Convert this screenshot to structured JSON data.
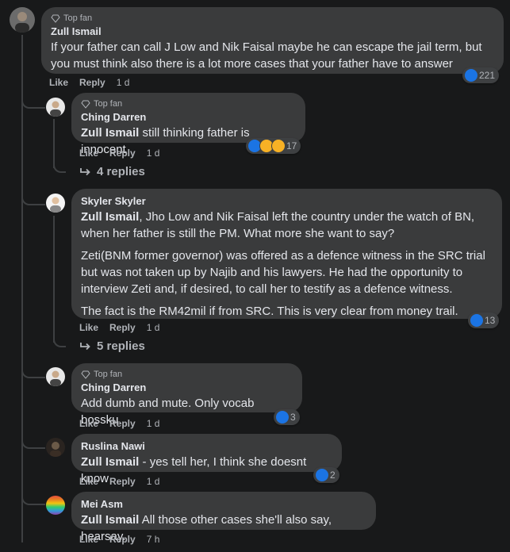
{
  "comments": [
    {
      "badge": "Top fan",
      "author": "Zull Ismail",
      "text": "If your father can call J Low and Nik Faisal maybe he can escape the jail term, but you must think also there is a lot more cases that your father have to answer",
      "like": "Like",
      "reply": "Reply",
      "time": "1 d",
      "reactions": "221"
    },
    {
      "badge": "Top fan",
      "author": "Ching Darren",
      "mention": "Zull Ismail",
      "text": " still thinking father is innocent",
      "like": "Like",
      "reply": "Reply",
      "time": "1 d",
      "reactions": "17",
      "replies": "4 replies"
    },
    {
      "author": "Skyler Skyler",
      "mention": "Zull Ismail",
      "text1": ", Jho Low and Nik Faisal left the country under the watch of BN, when her father is still the PM. What more she want to say?",
      "text2": "Zeti(BNM former governor) was offered as a defence witness in the SRC trial but was not taken up by Najib and his lawyers. He had the opportunity to interview Zeti and, if desired, to call her to testify as a defence witness.",
      "text3": "The fact is the RM42mil if from SRC. This is very clear from money trail.",
      "like": "Like",
      "reply": "Reply",
      "time": "1 d",
      "reactions": "13",
      "replies": "5 replies"
    },
    {
      "badge": "Top fan",
      "author": "Ching Darren",
      "text": "Add dumb and mute. Only vocab bossku",
      "like": "Like",
      "reply": "Reply",
      "time": "1 d",
      "reactions": "3"
    },
    {
      "author": "Ruslina Nawi",
      "mention": "Zull Ismail",
      "text": " - yes tell her, I think she doesnt know",
      "like": "Like",
      "reply": "Reply",
      "time": "1 d",
      "reactions": "2"
    },
    {
      "author": "Mei Asm",
      "mention": "Zull Ismail",
      "text": " All those other cases she'll also say, hearsay.",
      "like": "Like",
      "reply": "Reply",
      "time": "7 h"
    }
  ],
  "colors": {
    "background": "#18191a",
    "bubble": "#3a3b3c",
    "like_blue": "#1b74e4",
    "muted": "#b0b3b8"
  },
  "icons": [
    "diamond-icon",
    "like-icon",
    "haha-icon",
    "sad-icon",
    "reply-arrow-icon"
  ]
}
